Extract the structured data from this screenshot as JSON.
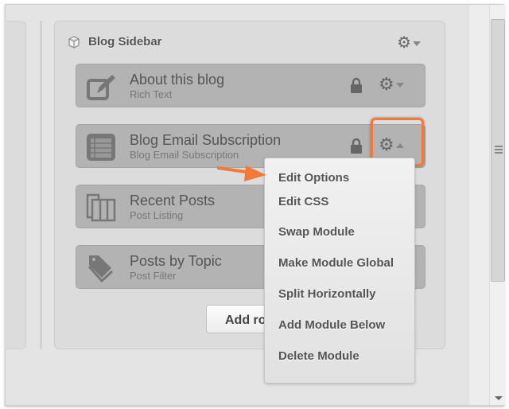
{
  "panel": {
    "title": "Blog Sidebar",
    "icon": "cube-icon"
  },
  "modules": [
    {
      "title": "About this blog",
      "subtitle": "Rich Text",
      "icon": "edit-icon",
      "locked": true,
      "menu_open": false
    },
    {
      "title": "Blog Email Subscription",
      "subtitle": "Blog Email Subscription",
      "icon": "form-icon",
      "locked": true,
      "menu_open": true
    },
    {
      "title": "Recent Posts",
      "subtitle": "Post Listing",
      "icon": "post-listing-icon"
    },
    {
      "title": "Posts by Topic",
      "subtitle": "Post Filter",
      "icon": "tag-icon"
    }
  ],
  "add_row_label": "Add row",
  "menu": {
    "items": [
      "Edit Options",
      "Edit CSS",
      "Swap Module",
      "Make Module Global",
      "Split Horizontally",
      "Add Module Below",
      "Delete Module"
    ]
  },
  "colors": {
    "highlight": "#f07a38",
    "arrow": "#f07a38"
  }
}
